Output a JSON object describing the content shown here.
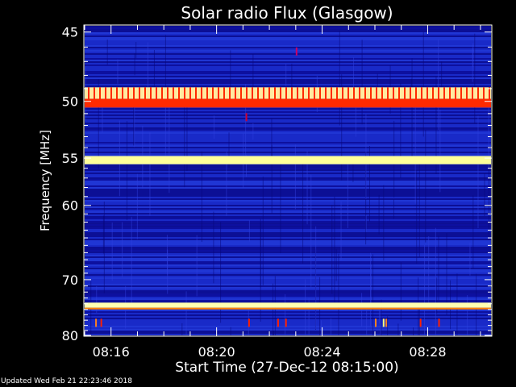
{
  "chart_data": {
    "type": "heatmap",
    "title": "Solar radio Flux (Glasgow)",
    "xlabel": "Start Time (27-Dec-12 08:15:00)",
    "ylabel": "Frequency [MHz]",
    "x_range_minutes": [
      0.0,
      15.4
    ],
    "x_ticks": [
      {
        "minute": 1,
        "label": "08:16"
      },
      {
        "minute": 5,
        "label": "08:20"
      },
      {
        "minute": 9,
        "label": "08:24"
      },
      {
        "minute": 13,
        "label": "08:28"
      }
    ],
    "y_range_mhz": [
      80.0,
      44.6
    ],
    "y_ticks": [
      {
        "value": 45,
        "label": "45"
      },
      {
        "value": 50,
        "label": "50"
      },
      {
        "value": 55,
        "label": "55"
      },
      {
        "value": 60,
        "label": "60"
      },
      {
        "value": 70,
        "label": "70"
      },
      {
        "value": 80,
        "label": "80"
      }
    ],
    "background_colors": [
      "#0a0a8c",
      "#1a2ac8",
      "#2238d6",
      "#0c0c98"
    ],
    "bands": [
      {
        "freq_from": 48.9,
        "freq_to": 49.8,
        "color": "#ffeaa0",
        "pulsed": true
      },
      {
        "freq_from": 49.8,
        "freq_to": 50.5,
        "color": "#ff2a00"
      },
      {
        "freq_from": 54.8,
        "freq_to": 55.6,
        "color": "#ffff99"
      },
      {
        "freq_from": 73.8,
        "freq_to": 74.7,
        "color": "#ffffb0"
      },
      {
        "freq_from": 74.7,
        "freq_to": 75.0,
        "color": "#ff8000"
      }
    ],
    "bursts": [
      {
        "minute": 0.4,
        "freq": 77.5,
        "color": "#ff8020"
      },
      {
        "minute": 0.6,
        "freq": 77.5,
        "color": "#ff2000"
      },
      {
        "minute": 6.2,
        "freq": 77.5,
        "color": "#ff2000"
      },
      {
        "minute": 7.3,
        "freq": 77.5,
        "color": "#ff2000"
      },
      {
        "minute": 7.6,
        "freq": 77.5,
        "color": "#ff2000"
      },
      {
        "minute": 11.0,
        "freq": 77.5,
        "color": "#ff8020"
      },
      {
        "minute": 11.3,
        "freq": 77.5,
        "color": "#ffff80"
      },
      {
        "minute": 11.4,
        "freq": 77.5,
        "color": "#ff8020"
      },
      {
        "minute": 12.7,
        "freq": 77.5,
        "color": "#ff2000"
      },
      {
        "minute": 13.4,
        "freq": 77.5,
        "color": "#ff2000"
      },
      {
        "minute": 8.0,
        "freq": 46.3,
        "color": "#cc0066"
      },
      {
        "minute": 6.1,
        "freq": 51.3,
        "color": "#cc0033"
      }
    ]
  },
  "footer": {
    "updated": "Updated Wed Feb 21 22:23:46 2018"
  }
}
